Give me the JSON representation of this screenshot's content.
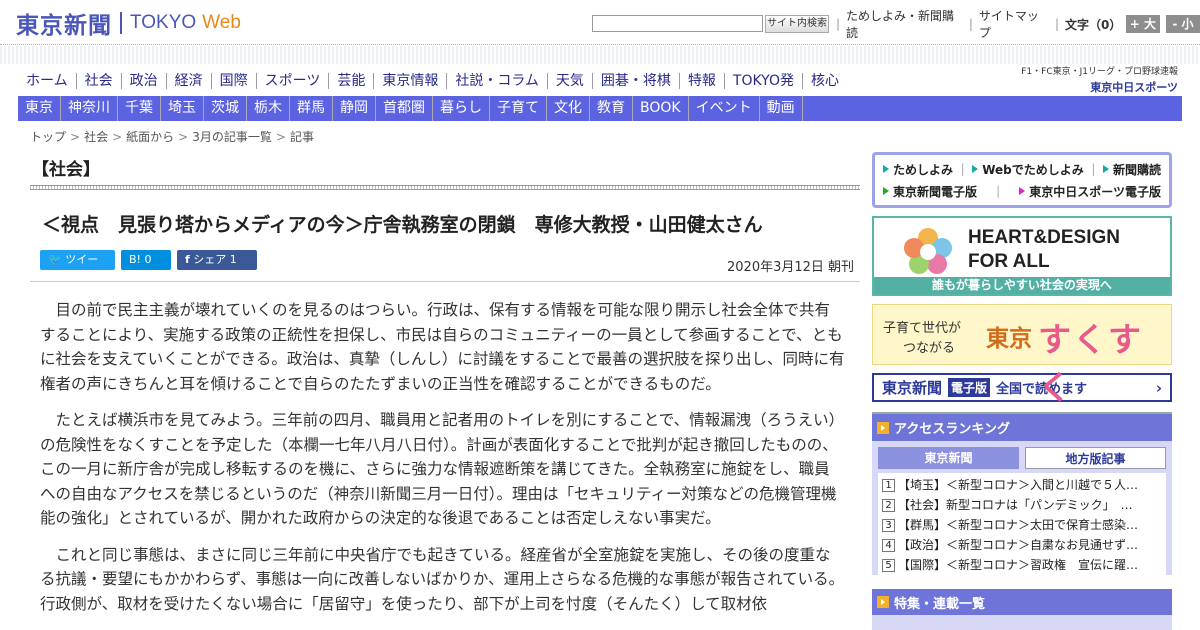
{
  "header": {
    "logo_jp": "東京新聞",
    "logo_tokyo": "TOKYO",
    "logo_web": "Web",
    "search_button": "サイト内検索",
    "links": [
      "ためしよみ・新聞購読",
      "サイトマップ"
    ],
    "font_size_label": "文字（0）",
    "font_bigger": "+ 大",
    "font_smaller": "- 小"
  },
  "main_nav": [
    "ホーム",
    "社会",
    "政治",
    "経済",
    "国際",
    "スポーツ",
    "芸能",
    "東京情報",
    "社説・コラム",
    "天気",
    "囲碁・将棋",
    "特報",
    "TOKYO発",
    "核心"
  ],
  "chunichi": {
    "sub": "F1・FC東京・J1リーグ・プロ野球速報",
    "brand": "東京中日スポーツ"
  },
  "sub_nav": [
    "東京",
    "神奈川",
    "千葉",
    "埼玉",
    "茨城",
    "栃木",
    "群馬",
    "静岡",
    "首都圏",
    "暮らし",
    "子育て",
    "文化",
    "教育",
    "BOOK",
    "イベント",
    "動画"
  ],
  "breadcrumb": [
    "トップ",
    "社会",
    "紙面から",
    "3月の記事一覧",
    "記事"
  ],
  "section": "【社会】",
  "article": {
    "title": "＜視点　見張り塔からメディアの今＞庁舎執務室の閉鎖　専修大教授・山田健太さん",
    "share": {
      "tweet": "ツイート",
      "hatena": "B! 0",
      "facebook": "シェア 1"
    },
    "date": "2020年3月12日 朝刊",
    "paragraphs": [
      "目の前で民主主義が壊れていくのを見るのはつらい。行政は、保有する情報を可能な限り開示し社会全体で共有することにより、実施する政策の正統性を担保し、市民は自らのコミュニティーの一員として参画することで、ともに社会を支えていくことができる。政治は、真摯（しんし）に討議をすることで最善の選択肢を探り出し、同時に有権者の声にきちんと耳を傾けることで自らのたたずまいの正当性を確認することができるものだ。",
      "たとえば横浜市を見てみよう。三年前の四月、職員用と記者用のトイレを別にすることで、情報漏洩（ろうえい）の危険性をなくすことを予定した（本欄一七年八月八日付）。計画が表面化することで批判が起き撤回したものの、この一月に新庁舎が完成し移転するのを機に、さらに強力な情報遮断策を講じてきた。全執務室に施錠をし、職員への自由なアクセスを禁じるというのだ（神奈川新聞三月一日付）。理由は「セキュリティー対策などの危機管理機能の強化」とされているが、開かれた政府からの決定的な後退であることは否定しえない事実だ。",
      "これと同じ事態は、まさに同じ三年前に中央省庁でも起きている。経産省が全室施錠を実施し、その後の度重なる抗議・要望にもかかわらず、事態は一向に改善しないばかりか、運用上さらなる危機的な事態が報告されている。行政側が、取材を受けたくない場合に「居留守」を使ったり、部下が上司を忖度（そんたく）して取材依"
    ]
  },
  "sidebar": {
    "quick_links": [
      "ためしよみ",
      "Webでためしよみ",
      "新聞購読",
      "東京新聞電子版",
      "東京中日スポーツ電子版"
    ],
    "heart": {
      "line1": "HEART&DESIGN",
      "line2": "FOR ALL",
      "band": "誰もが暮らしやすい社会の実現へ"
    },
    "sukusuku": {
      "l1": "子育て世代が",
      "l2": "つながる",
      "tokyo": "東京",
      "name": "すくすく"
    },
    "denshi": {
      "name": "東京新聞",
      "edition": "電子版",
      "tagline": "全国で読めます"
    },
    "ranking": {
      "title": "アクセスランキング",
      "tabs": [
        "東京新聞",
        "地方版記事"
      ],
      "items": [
        "【埼玉】＜新型コロナ＞入間と川越で５人…",
        "【社会】新型コロナは「パンデミック」　…",
        "【群馬】＜新型コロナ＞太田で保育士感染…",
        "【政治】＜新型コロナ＞自粛なお見通せず…",
        "【国際】＜新型コロナ＞習政権　宣伝に躍…"
      ]
    },
    "feature_title": "特集・連載一覧"
  }
}
